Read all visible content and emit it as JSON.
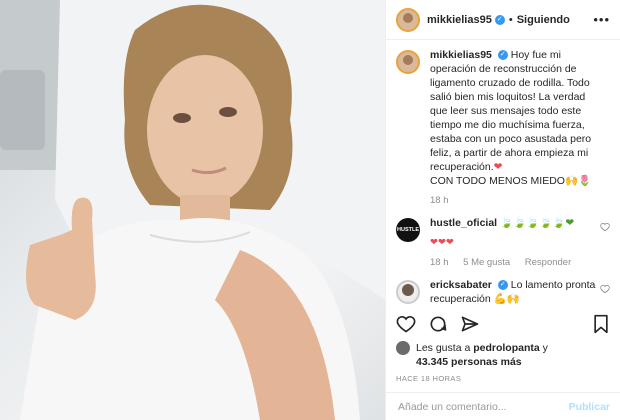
{
  "post": {
    "username": "mikkielias95",
    "verified_mark": "✓",
    "separator": "•",
    "follow_status": "Siguiendo",
    "more_options": "•••",
    "caption": "Hoy fue mi operación de reconstrucción de ligamento cruzado de rodilla. Todo salió bien mis loquitos! La verdad que leer sus mensajes todo este tiempo me dio muchísima fuerza, estaba con un poco asustada pero feliz, a partir de ahora empieza mi recuperación.",
    "caption_tail": "CON TODO MENOS MIEDO",
    "caption_emoji_1": "❤",
    "caption_emoji_2": "🙌🌷",
    "caption_time": "18 h"
  },
  "comments": [
    {
      "username": "hustle_oficial",
      "avatar_text": "HUSTLE",
      "text_emoji": "🍃🍃🍃🍃🍃❤",
      "time": "18 h"
    },
    {
      "username": "hustle_oficial",
      "text_emoji": "❤❤❤",
      "time": "18 h",
      "likes": "5 Me gusta",
      "reply": "Responder"
    },
    {
      "username": "ericksabater",
      "text": "Lo lamento pronta recuperación",
      "text_emoji": "💪🙌"
    }
  ],
  "likes": {
    "prefix": "Les gusta a",
    "user": "pedrolopanta",
    "joiner": "y",
    "count": "43.345 personas más"
  },
  "timestamp": "HACE 18 HORAS",
  "composer": {
    "placeholder": "Añade un comentario...",
    "publish": "Publicar"
  }
}
